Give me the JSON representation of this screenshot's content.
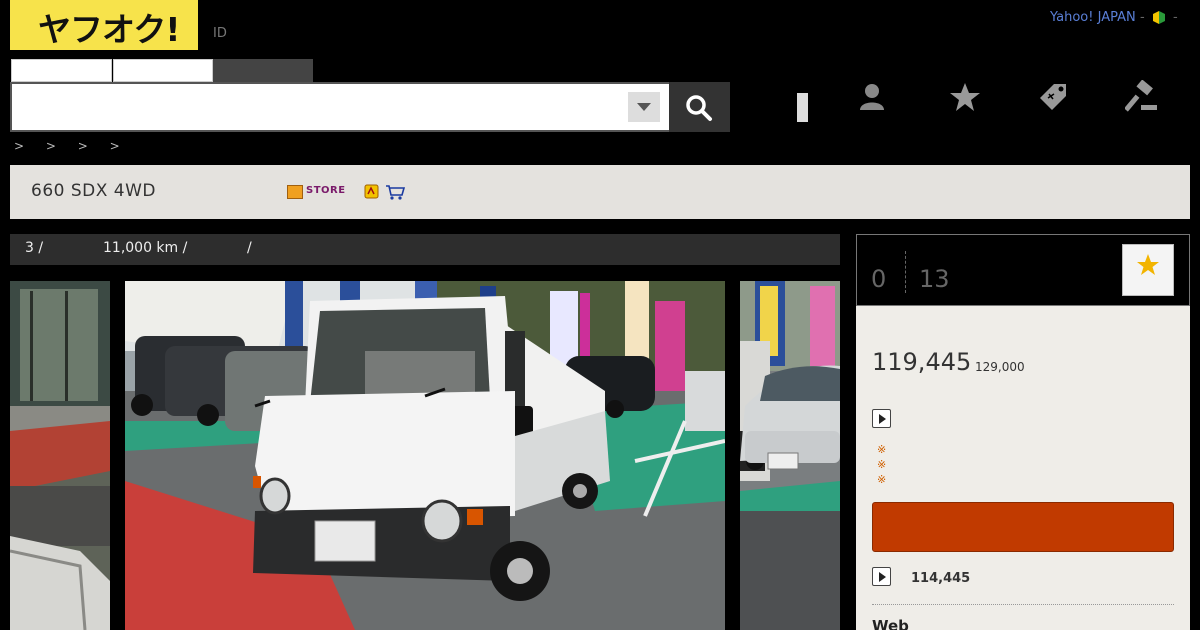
{
  "header": {
    "logo_text": "ヤフオク!",
    "id_label": "ID",
    "yahoo_japan_link": "Yahoo! JAPAN",
    "separator": "-",
    "beginner_icon": "beginner-leaf-icon"
  },
  "search": {
    "placeholder": "",
    "dropdown_icon": "chevron-down-icon",
    "search_icon": "search-icon"
  },
  "nav_icons": [
    "user-icon",
    "star-icon",
    "tag-icon",
    "gavel-icon"
  ],
  "breadcrumb": "> > > >",
  "item": {
    "title": "660 SDX 4WD",
    "store_label": "STORE",
    "store_icon": "store-icon",
    "badge_icon": "hand-badge-icon",
    "cart_icon": "cart-icon"
  },
  "spec": {
    "part1": "3 /",
    "part2": "11,000 km /",
    "part3": "/"
  },
  "photos": {
    "main_alt": "white kei truck in a car dealership lot",
    "left_alt": "truck bed side view",
    "right_alt": "silver car in lot"
  },
  "sidebar": {
    "watch_count": "0",
    "bid_count": "13",
    "watch_icon": "star-icon",
    "current_price": "119,445",
    "current_price_sub": "129,000",
    "note_mark": "※",
    "buy_now_price": "114,445",
    "web_label": "Web"
  },
  "colors": {
    "logo_yellow": "#f7e34b",
    "bid_button": "#c13a00",
    "yahoo_link": "#5a7fd6"
  }
}
